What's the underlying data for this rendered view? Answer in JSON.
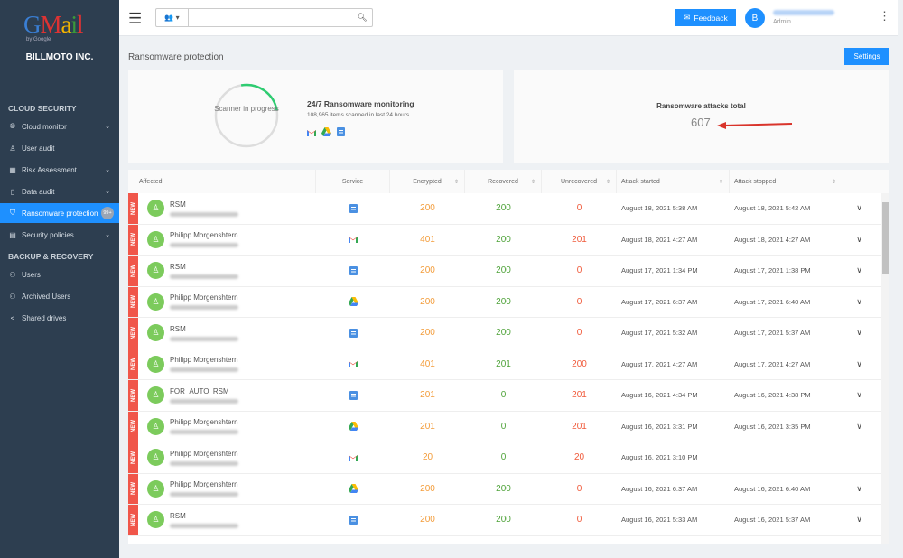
{
  "sidebar": {
    "logo": "Gmail",
    "logo_sub": "by Google",
    "company": "BILLMOTO INC.",
    "sections": [
      {
        "title": "CLOUD SECURITY",
        "items": [
          {
            "label": "Cloud monitor",
            "icon": "globe-icon",
            "chevron": true
          },
          {
            "label": "User audit",
            "icon": "user-icon",
            "chevron": false
          },
          {
            "label": "Risk Assessment",
            "icon": "grid-icon",
            "chevron": true
          },
          {
            "label": "Data audit",
            "icon": "book-icon",
            "chevron": true
          },
          {
            "label": "Ransomware protection",
            "icon": "shield-icon",
            "chevron": false,
            "active": true,
            "badge": "99+"
          },
          {
            "label": "Security policies",
            "icon": "policy-icon",
            "chevron": true
          }
        ]
      },
      {
        "title": "BACKUP & RECOVERY",
        "items": [
          {
            "label": "Users",
            "icon": "users-icon"
          },
          {
            "label": "Archived Users",
            "icon": "users-icon"
          },
          {
            "label": "Shared drives",
            "icon": "share-icon"
          }
        ]
      }
    ]
  },
  "topbar": {
    "search_placeholder": "",
    "feedback": "Feedback",
    "avatar_letter": "B",
    "role": "Admin"
  },
  "page": {
    "title": "Ransomware protection",
    "settings": "Settings"
  },
  "scanner": {
    "status": "Scanner in progress",
    "title": "24/7 Ransomware monitoring",
    "subtitle": "108,965 items scanned in last 24 hours",
    "progress": 0.25,
    "services": [
      "gmail",
      "drive",
      "sites"
    ]
  },
  "attacks": {
    "label": "Ransomware attacks total",
    "value": "607"
  },
  "colors": {
    "accent": "#1e90ff",
    "sidebar": "#2d3e50",
    "new": "#f0564a",
    "encrypted": "#f39c3a",
    "recovered": "#4fa33a",
    "unrecovered": "#f05a3a"
  },
  "table": {
    "headers": [
      "Affected",
      "Service",
      "Encrypted",
      "Recovered",
      "Unrecovered",
      "Attack started",
      "Attack stopped"
    ],
    "new_label": "NEW",
    "rows": [
      {
        "name": "RSM",
        "service": "sites",
        "enc": "200",
        "rec": "200",
        "unr": "0",
        "start": "August 18, 2021 5:38 AM",
        "stop": "August 18, 2021 5:42 AM"
      },
      {
        "name": "Philipp Morgenshtern",
        "service": "gmail",
        "enc": "401",
        "rec": "200",
        "unr": "201",
        "start": "August 18, 2021 4:27 AM",
        "stop": "August 18, 2021 4:27 AM"
      },
      {
        "name": "RSM",
        "service": "sites",
        "enc": "200",
        "rec": "200",
        "unr": "0",
        "start": "August 17, 2021 1:34 PM",
        "stop": "August 17, 2021 1:38 PM"
      },
      {
        "name": "Philipp Morgenshtern",
        "service": "drive",
        "enc": "200",
        "rec": "200",
        "unr": "0",
        "start": "August 17, 2021 6:37 AM",
        "stop": "August 17, 2021 6:40 AM"
      },
      {
        "name": "RSM",
        "service": "sites",
        "enc": "200",
        "rec": "200",
        "unr": "0",
        "start": "August 17, 2021 5:32 AM",
        "stop": "August 17, 2021 5:37 AM"
      },
      {
        "name": "Philipp Morgenshtern",
        "service": "gmail",
        "enc": "401",
        "rec": "201",
        "unr": "200",
        "start": "August 17, 2021 4:27 AM",
        "stop": "August 17, 2021 4:27 AM"
      },
      {
        "name": "FOR_AUTO_RSM",
        "service": "sites",
        "enc": "201",
        "rec": "0",
        "unr": "201",
        "start": "August 16, 2021 4:34 PM",
        "stop": "August 16, 2021 4:38 PM"
      },
      {
        "name": "Philipp Morgenshtern",
        "service": "drive",
        "enc": "201",
        "rec": "0",
        "unr": "201",
        "start": "August 16, 2021 3:31 PM",
        "stop": "August 16, 2021 3:35 PM"
      },
      {
        "name": "Philipp Morgenshtern",
        "service": "gmail",
        "enc": "20",
        "rec": "0",
        "unr": "20",
        "start": "August 16, 2021 3:10 PM",
        "stop": ""
      },
      {
        "name": "Philipp Morgenshtern",
        "service": "drive",
        "enc": "200",
        "rec": "200",
        "unr": "0",
        "start": "August 16, 2021 6:37 AM",
        "stop": "August 16, 2021 6:40 AM"
      },
      {
        "name": "RSM",
        "service": "sites",
        "enc": "200",
        "rec": "200",
        "unr": "0",
        "start": "August 16, 2021 5:33 AM",
        "stop": "August 16, 2021 5:37 AM"
      }
    ]
  }
}
